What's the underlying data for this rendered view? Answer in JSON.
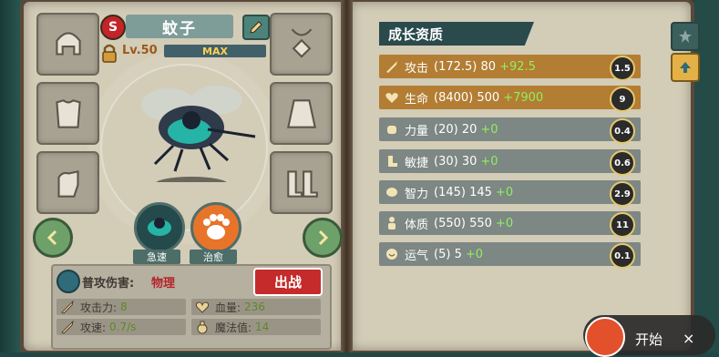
{
  "character": {
    "rank": "S",
    "name": "蚊子",
    "level": "Lv.50",
    "max_label": "MAX"
  },
  "skills": [
    {
      "label": "急速"
    },
    {
      "label": "治愈"
    }
  ],
  "info": {
    "attack_type_label": "普攻伤害:",
    "attack_type_value": "物理",
    "deploy_label": "出战",
    "stats": [
      {
        "label": "攻击力:",
        "value": "8"
      },
      {
        "label": "血量:",
        "value": "236"
      },
      {
        "label": "攻速:",
        "value": "0.7/s"
      },
      {
        "label": "魔法值:",
        "value": "14"
      }
    ]
  },
  "growth": {
    "title": "成长资质",
    "rows": [
      {
        "label": "攻击",
        "base": "(172.5) 80",
        "bonus": "+92.5",
        "badge": "1.5",
        "icon": "sword-icon"
      },
      {
        "label": "生命",
        "base": "(8400) 500",
        "bonus": "+7900",
        "badge": "9",
        "icon": "heart-icon"
      },
      {
        "label": "力量",
        "base": "(20) 20",
        "bonus": "+0",
        "badge": "0.4",
        "icon": "fist-icon"
      },
      {
        "label": "敏捷",
        "base": "(30) 30",
        "bonus": "+0",
        "badge": "0.6",
        "icon": "boot-icon"
      },
      {
        "label": "智力",
        "base": "(145) 145",
        "bonus": "+0",
        "badge": "2.9",
        "icon": "brain-icon"
      },
      {
        "label": "体质",
        "base": "(550) 550",
        "bonus": "+0",
        "badge": "11",
        "icon": "body-icon"
      },
      {
        "label": "运气",
        "base": "(5) 5",
        "bonus": "+0",
        "badge": "0.1",
        "icon": "clover-icon"
      }
    ]
  },
  "overlay": {
    "start_label": "开始",
    "close_label": "×"
  },
  "colors": {
    "highlight_row": "#b37d33",
    "normal_row": "#7d8784",
    "bonus_green": "#8ff05e",
    "deploy_red": "#c52b2b"
  }
}
